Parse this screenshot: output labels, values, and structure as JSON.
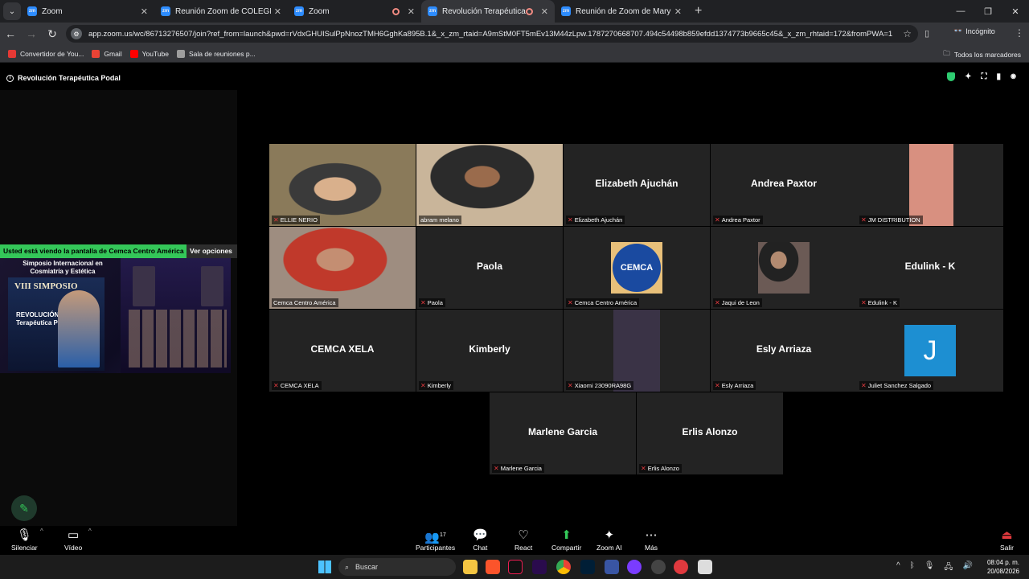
{
  "browser": {
    "tabs": [
      {
        "label": "Zoom",
        "active": false,
        "recording": false
      },
      {
        "label": "Reunión Zoom de COLEGIO MI",
        "active": false,
        "recording": false
      },
      {
        "label": "Zoom",
        "active": false,
        "recording": true
      },
      {
        "label": "Revolución Terapéutica Pod",
        "active": true,
        "recording": true
      },
      {
        "label": "Reunión de Zoom de Mary Rob",
        "active": false,
        "recording": false
      }
    ],
    "url": "app.zoom.us/wc/86713276507/join?ref_from=launch&pwd=rVdxGHUISulPpNnozTMH6GghKa895B.1&_x_zm_rtaid=A9mStM0FT5mEv13M44zLpw.1787270668707.494c54498b859efdd1374773b9665c45&_x_zm_rhtaid=172&fromPWA=1",
    "incognito_label": "Incógnito",
    "bookmarks": [
      {
        "label": "Convertidor de You...",
        "color": "#e53935"
      },
      {
        "label": "Gmail",
        "color": "#ea4335"
      },
      {
        "label": "YouTube",
        "color": "#ff0000"
      },
      {
        "label": "Sala de reuniones p...",
        "color": "#9e9e9e"
      }
    ],
    "all_bookmarks_label": "Todos los marcadores"
  },
  "meeting": {
    "title": "Revolución Terapéutica Podal",
    "share_banner": "Usted está viendo la pantalla de  Cemca Centro América",
    "view_options": "Ver opciones",
    "poster": {
      "title": "Simposio Internacional en Cosmiatría y Estética",
      "heading": "VIII SIMPOSIO",
      "subheading": "REVOLUCIÓN Terapéutica PODAL"
    }
  },
  "participants": [
    {
      "name": "ELLIE NERIO",
      "video": true,
      "speaking": true,
      "mic_muted": true
    },
    {
      "name": "abram melano",
      "video": true,
      "speaking": false,
      "mic_muted": false
    },
    {
      "name": "Elizabeth Ajuchán",
      "video": false,
      "mic_muted": true
    },
    {
      "name": "Andrea Paxtor",
      "video": false,
      "mic_muted": true
    },
    {
      "name": "JM DISTRIBUTION",
      "video": true,
      "mic_muted": true
    },
    {
      "name": "Cemca Centro América",
      "video": true,
      "mic_muted": false
    },
    {
      "name": "Paola",
      "video": false,
      "mic_muted": true
    },
    {
      "name": "Cemca Centro América",
      "video": false,
      "avatar": "CEMCA",
      "mic_muted": true
    },
    {
      "name": "Jaqui de Leon",
      "video": false,
      "avatar": "photo",
      "mic_muted": true
    },
    {
      "name": "Edulink - K",
      "video": false,
      "mic_muted": true
    },
    {
      "name": "CEMCA XELA",
      "video": false,
      "mic_muted": true
    },
    {
      "name": "Kimberly",
      "video": false,
      "mic_muted": true
    },
    {
      "name": "Xiaomi 23090RA98G",
      "video": true,
      "mic_muted": true
    },
    {
      "name": "Esly Arriaza",
      "video": false,
      "mic_muted": true
    },
    {
      "name": "Juliet Sanchez Salgado",
      "video": false,
      "avatar": "J",
      "mic_muted": true
    },
    {
      "name": "Marlene Garcia",
      "video": false,
      "mic_muted": true
    },
    {
      "name": "Erlis Alonzo",
      "video": false,
      "mic_muted": true
    }
  ],
  "toolbar": {
    "mute": "Silenciar",
    "video": "Vídeo",
    "participants": "Participantes",
    "participants_count": "17",
    "chat": "Chat",
    "react": "React",
    "share": "Compartir",
    "zoom_ai": "Zoom AI",
    "more": "Más",
    "leave": "Salir"
  },
  "taskbar": {
    "search_placeholder": "Buscar",
    "time": "08:04 p. m.",
    "date": "20/08/2026"
  }
}
